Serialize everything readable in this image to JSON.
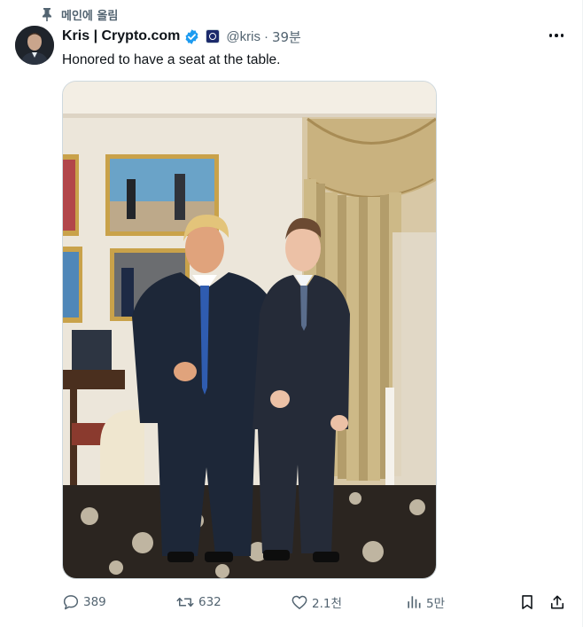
{
  "pinned": {
    "label": "메인에 올림",
    "icon": "pin-icon"
  },
  "author": {
    "display_name": "Kris | Crypto.com",
    "handle": "@kris",
    "separator": "·",
    "timestamp": "39분",
    "verified_icon": "verified-badge-icon",
    "affiliate_icon": "crypto-com-affiliate-badge-icon",
    "verified_color": "#1d9bf0"
  },
  "tweet": {
    "text": "Honored to have a seat at the table.",
    "media": "photo"
  },
  "actions": {
    "reply_count": "389",
    "retweet_count": "632",
    "like_count": "2.1천",
    "views_count": "5만"
  },
  "colors": {
    "text": "#0f1419",
    "secondary": "#536471",
    "border": "#cfd9de"
  }
}
